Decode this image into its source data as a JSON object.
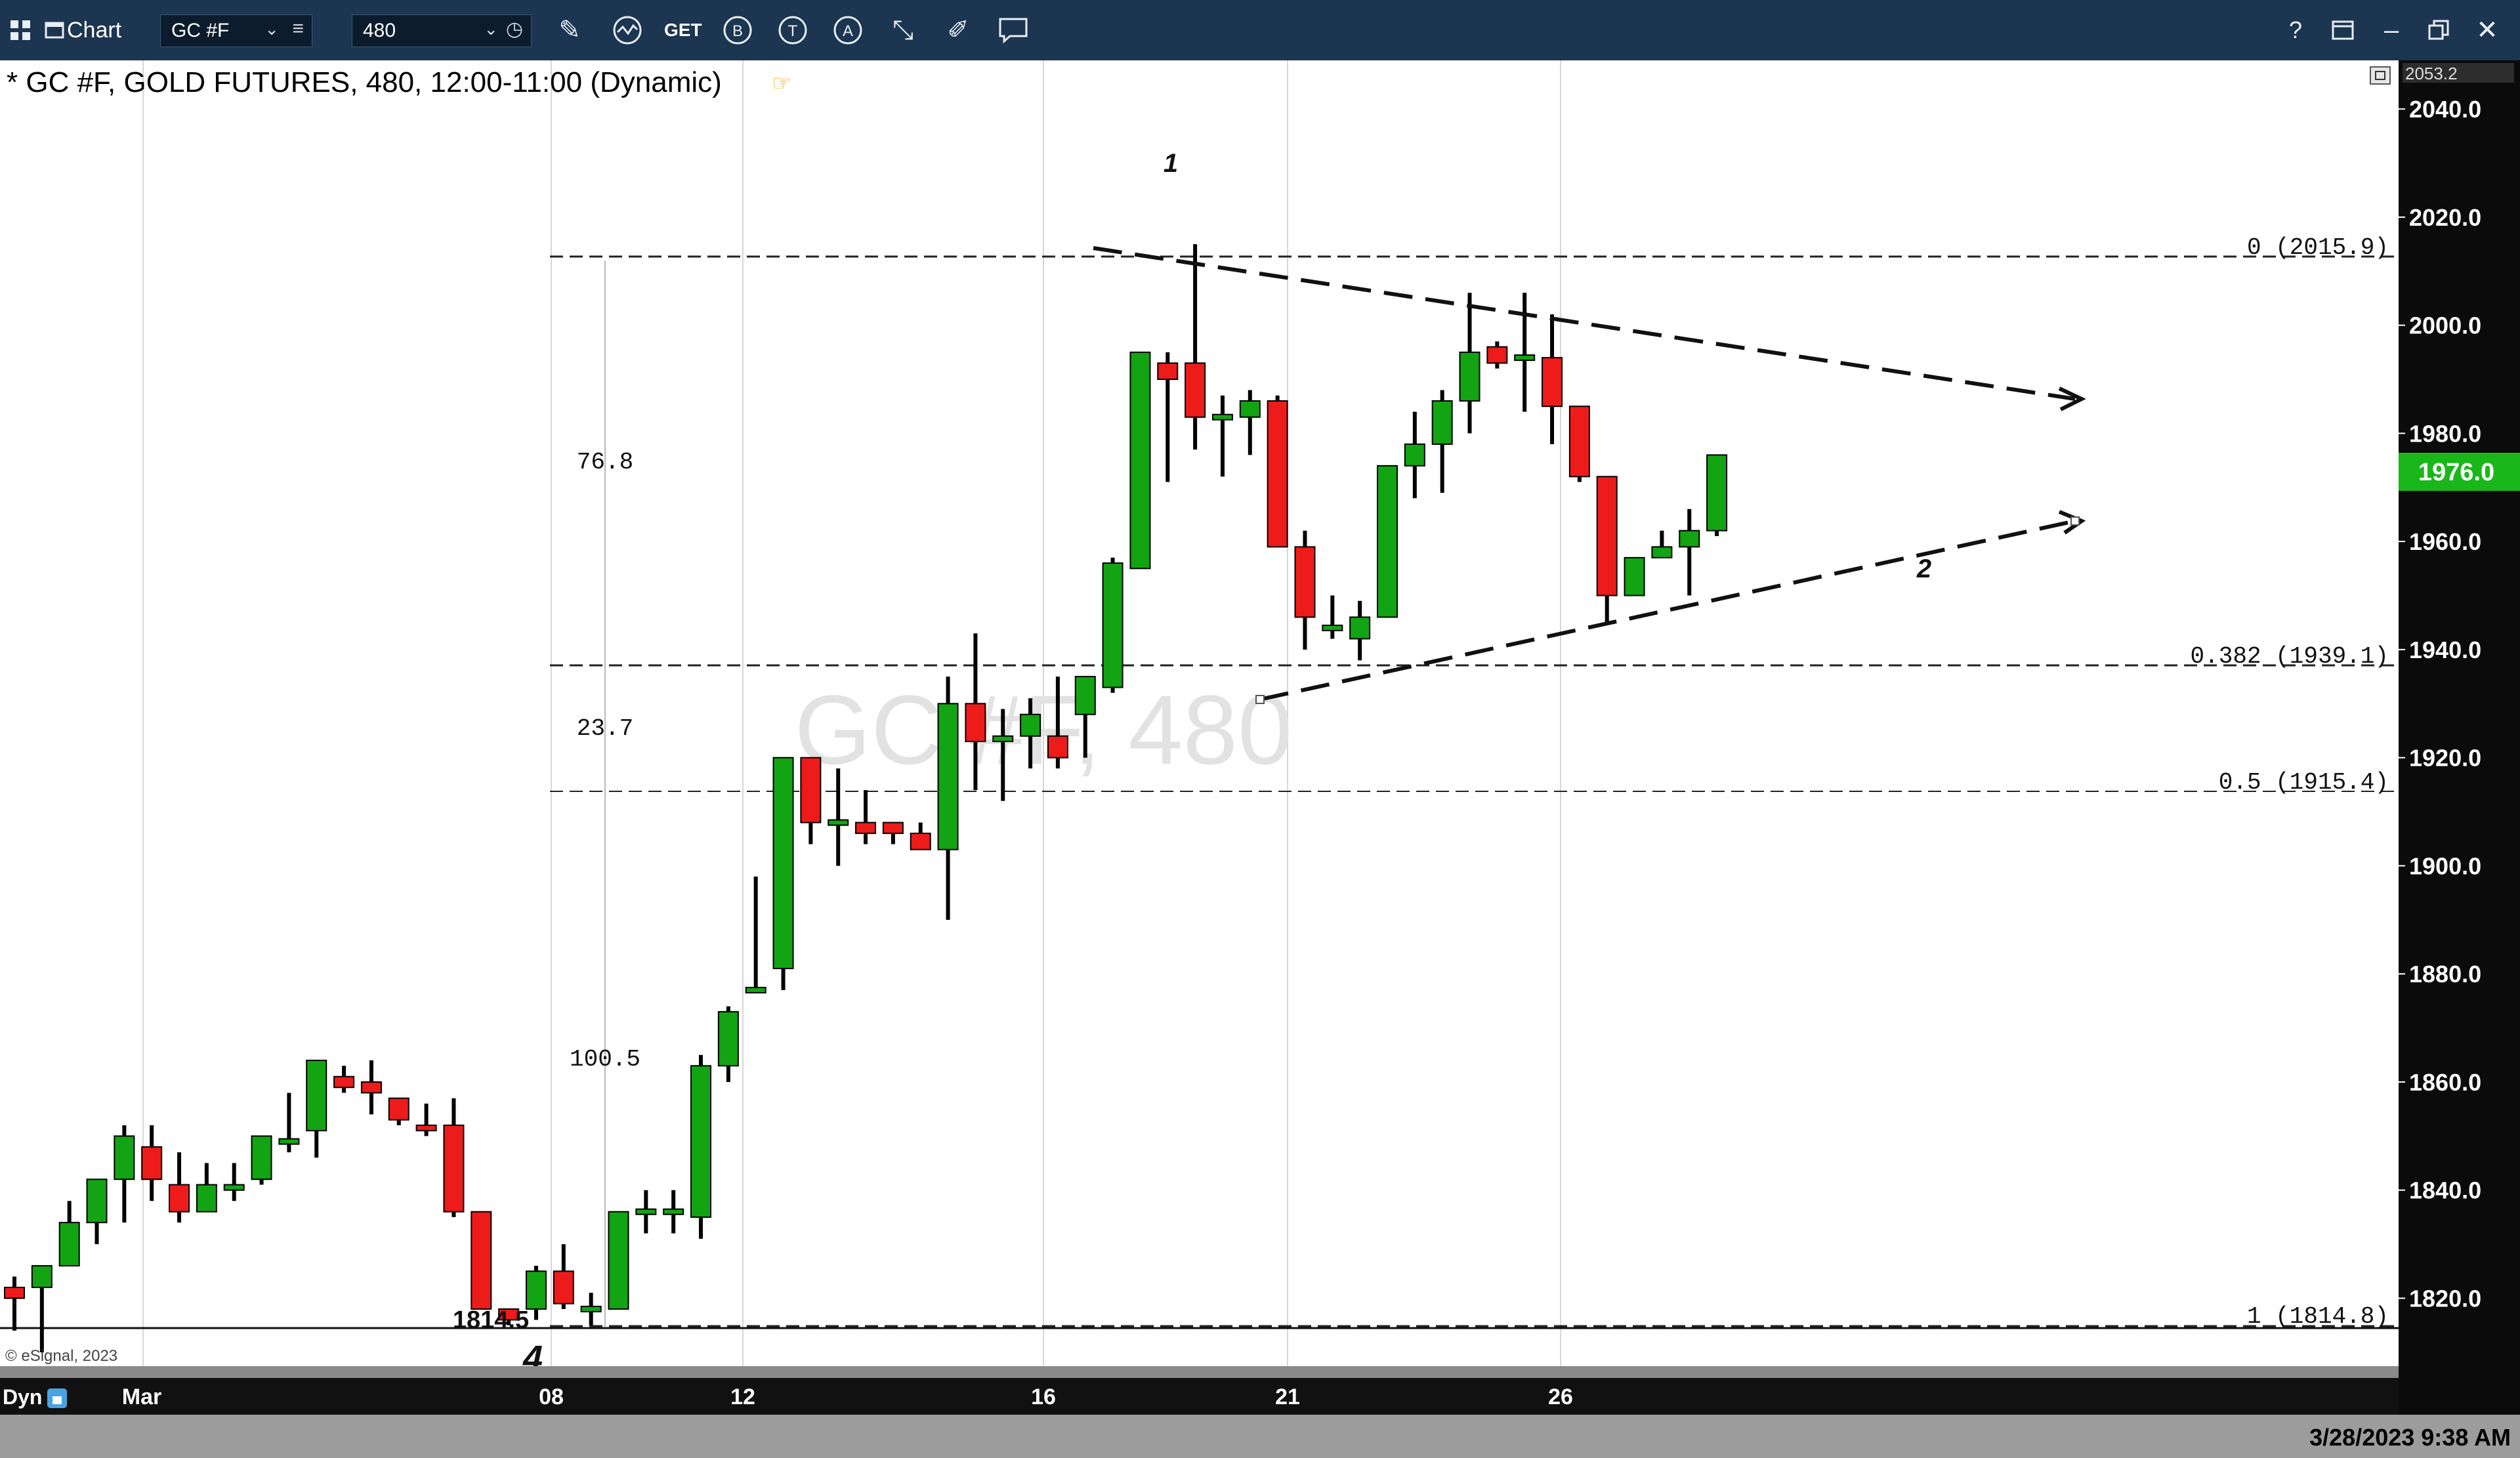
{
  "toolbar": {
    "title": "Chart",
    "symbol": "GC #F",
    "interval": "480",
    "get_label": "GET",
    "btn_b": "B",
    "btn_t": "T",
    "btn_a": "A",
    "help": "?",
    "minimize": "–"
  },
  "chart": {
    "header": "* GC #F, GOLD FUTURES, 480, 12:00-11:00 (Dynamic)",
    "watermark": "GC #F, 480",
    "copyright": "© eSignal, 2023",
    "top_price_box": "2053.2",
    "last_price": "1976.0",
    "price_labels": [
      "2040.0",
      "2020.0",
      "2000.0",
      "1980.0",
      "1960.0",
      "1940.0",
      "1920.0",
      "1900.0",
      "1880.0",
      "1860.0",
      "1840.0",
      "1820.0"
    ],
    "date_labels": [
      "Mar",
      "08",
      "12",
      "16",
      "21",
      "26"
    ],
    "dyn_label": "Dyn",
    "fib_labels": [
      "0 (2015.9)",
      "0.382 (1939.1)",
      "0.5 (1915.4)",
      "1 (1814.8)"
    ],
    "measure_labels": [
      "76.8",
      "23.7",
      "100.5"
    ],
    "low_label": "1814.5",
    "wave_labels": [
      "1",
      "2",
      "4"
    ],
    "colors": {
      "up": "#12a412",
      "down": "#ee1b1b",
      "toolbar": "#1c3550",
      "last_price_bg": "#19b719"
    }
  },
  "chart_data": {
    "type": "candlestick",
    "title": "* GC #F, GOLD FUTURES, 480, 12:00-11:00 (Dynamic)",
    "ylim": [
      1806,
      2053.2
    ],
    "x_ticks": [
      "Mar",
      "08",
      "12",
      "16",
      "21",
      "26"
    ],
    "candles": [
      [
        1822,
        1824,
        1814,
        1820
      ],
      [
        1822,
        1826,
        1810,
        1826
      ],
      [
        1826,
        1838,
        1826,
        1834
      ],
      [
        1834,
        1840,
        1830,
        1842
      ],
      [
        1842,
        1852,
        1834,
        1850
      ],
      [
        1848,
        1852,
        1838,
        1842
      ],
      [
        1841,
        1847,
        1834,
        1836
      ],
      [
        1836,
        1845,
        1836,
        1841
      ],
      [
        1840,
        1845,
        1838,
        1841
      ],
      [
        1842,
        1850,
        1841,
        1850
      ],
      [
        1849,
        1858,
        1847,
        1849
      ],
      [
        1851,
        1864,
        1846,
        1864
      ],
      [
        1861,
        1863,
        1858,
        1859
      ],
      [
        1860,
        1864,
        1854,
        1858
      ],
      [
        1857,
        1855,
        1852,
        1853
      ],
      [
        1852,
        1856,
        1850,
        1851
      ],
      [
        1852,
        1857,
        1835,
        1836
      ],
      [
        1836,
        1835,
        1818,
        1818
      ],
      [
        1818,
        1816,
        1815,
        1816
      ],
      [
        1818,
        1826,
        1816,
        1825
      ],
      [
        1825,
        1830,
        1818,
        1819
      ],
      [
        1818,
        1821,
        1815,
        1818
      ],
      [
        1818,
        1836,
        1818,
        1836
      ],
      [
        1836,
        1840,
        1832,
        1836
      ],
      [
        1836,
        1840,
        1832,
        1836
      ],
      [
        1835,
        1865,
        1831,
        1863
      ],
      [
        1863,
        1874,
        1860,
        1873
      ],
      [
        1877,
        1898,
        1877,
        1877
      ],
      [
        1881,
        1920,
        1877,
        1920
      ],
      [
        1920,
        1920,
        1904,
        1908
      ],
      [
        1908,
        1918,
        1900,
        1908
      ],
      [
        1908,
        1914,
        1904,
        1906
      ],
      [
        1908,
        1906,
        1904,
        1906
      ],
      [
        1906,
        1908,
        1903,
        1903
      ],
      [
        1903,
        1935,
        1890,
        1930
      ],
      [
        1930,
        1943,
        1914,
        1923
      ],
      [
        1923,
        1929,
        1912,
        1924
      ],
      [
        1924,
        1931,
        1918,
        1928
      ],
      [
        1924,
        1935,
        1918,
        1920
      ],
      [
        1928,
        1935,
        1920,
        1935
      ],
      [
        1933,
        1957,
        1932,
        1956
      ],
      [
        1955,
        1995,
        1955,
        1995
      ],
      [
        1993,
        1995,
        1971,
        1990
      ],
      [
        1993,
        2015,
        1977,
        1983
      ],
      [
        1983,
        1987,
        1972,
        1983
      ],
      [
        1983,
        1988,
        1976,
        1986
      ],
      [
        1986,
        1987,
        1959,
        1959
      ],
      [
        1959,
        1962,
        1940,
        1946
      ],
      [
        1944,
        1950,
        1942,
        1944
      ],
      [
        1942,
        1949,
        1938,
        1946
      ],
      [
        1946,
        1974,
        1946,
        1974
      ],
      [
        1974,
        1984,
        1968,
        1978
      ],
      [
        1978,
        1988,
        1969,
        1986
      ],
      [
        1986,
        2006,
        1980,
        1995
      ],
      [
        1996,
        1997,
        1992,
        1993
      ],
      [
        1994,
        2006,
        1984,
        1994
      ],
      [
        1994,
        2002,
        1978,
        1985
      ],
      [
        1985,
        1983,
        1971,
        1972
      ],
      [
        1972,
        1969,
        1945,
        1950
      ],
      [
        1950,
        1957,
        1950,
        1957
      ],
      [
        1957,
        1962,
        1957,
        1959
      ],
      [
        1959,
        1966,
        1950,
        1962
      ],
      [
        1962,
        1976,
        1961,
        1976
      ]
    ]
  }
}
